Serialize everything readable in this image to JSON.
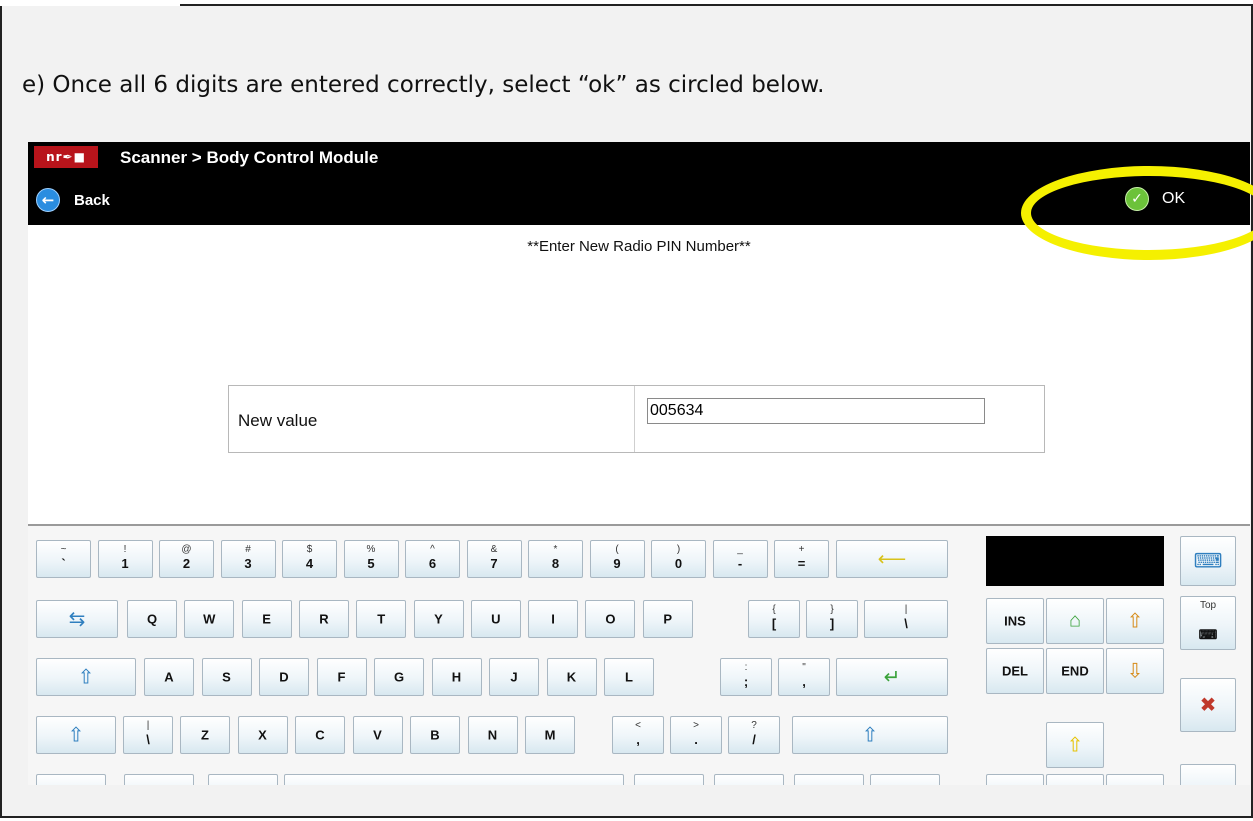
{
  "instruction": "e)  Once all 6 digits are entered correctly, select “ok” as circled below.",
  "app": {
    "icon_text": "nr✒■",
    "breadcrumb": "Scanner   > Body Control Module",
    "back_label": "Back",
    "ok_label": "OK"
  },
  "prompt": "**Enter New Radio PIN Number**",
  "field": {
    "label": "New value",
    "value": "005634"
  },
  "keyboard": {
    "row1": [
      {
        "top": "~",
        "bot": "`"
      },
      {
        "top": "!",
        "bot": "1"
      },
      {
        "top": "@",
        "bot": "2"
      },
      {
        "top": "#",
        "bot": "3"
      },
      {
        "top": "$",
        "bot": "4"
      },
      {
        "top": "%",
        "bot": "5"
      },
      {
        "top": "^",
        "bot": "6"
      },
      {
        "top": "&",
        "bot": "7"
      },
      {
        "top": "*",
        "bot": "8"
      },
      {
        "top": "(",
        "bot": "9"
      },
      {
        "top": ")",
        "bot": "0"
      },
      {
        "top": "_",
        "bot": "-"
      },
      {
        "top": "+",
        "bot": "="
      }
    ],
    "row2": [
      "Q",
      "W",
      "E",
      "R",
      "T",
      "Y",
      "U",
      "I",
      "O",
      "P"
    ],
    "row2_brackets": [
      {
        "top": "{",
        "bot": "["
      },
      {
        "top": "}",
        "bot": "]"
      },
      {
        "top": "|",
        "bot": "\\"
      }
    ],
    "row3": [
      "A",
      "S",
      "D",
      "F",
      "G",
      "H",
      "J",
      "K",
      "L"
    ],
    "row3_punct": [
      {
        "top": ":",
        "bot": ";"
      },
      {
        "top": "\"",
        "bot": ","
      }
    ],
    "row4_first": {
      "top": "|",
      "bot": "\\"
    },
    "row4": [
      "Z",
      "X",
      "C",
      "V",
      "B",
      "N",
      "M"
    ],
    "row4_punct": [
      {
        "top": "<",
        "bot": ","
      },
      {
        "top": ">",
        "bot": "."
      },
      {
        "top": "?",
        "bot": "/"
      }
    ],
    "nav": {
      "ins": "INS",
      "del": "DEL",
      "end": "END",
      "top": "Top"
    }
  },
  "colors": {
    "highlight_circle": "#f5f000",
    "topbar": "#000000",
    "app_icon": "#b8141b"
  }
}
